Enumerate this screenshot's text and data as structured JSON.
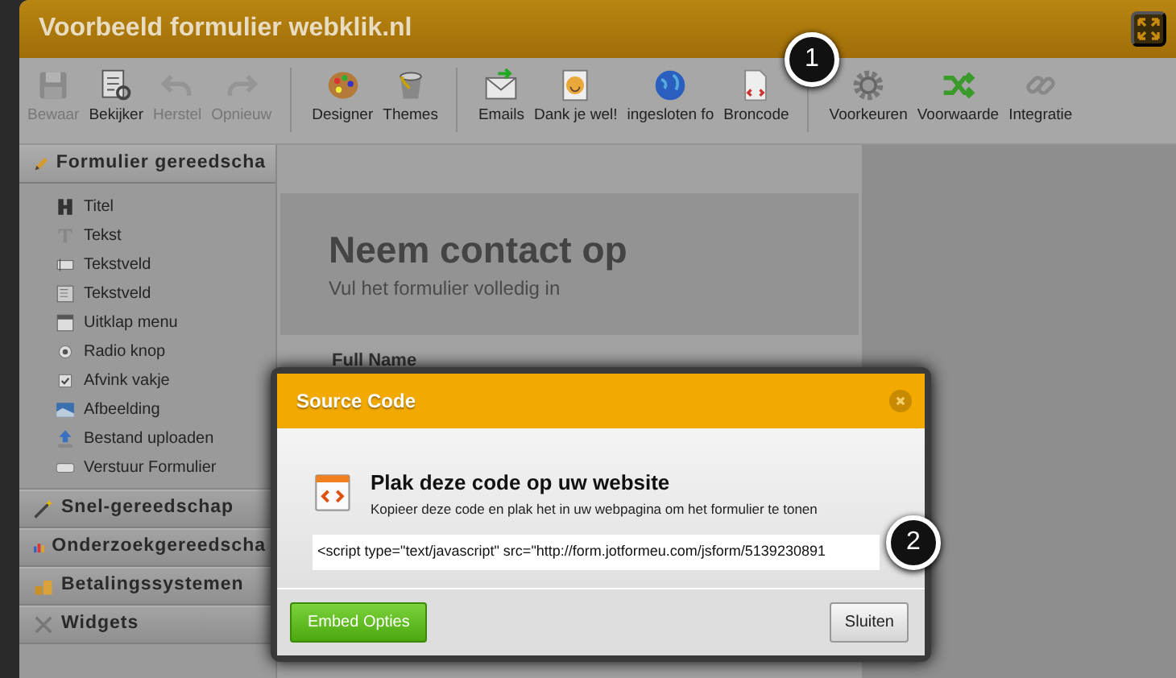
{
  "window": {
    "title": "Voorbeeld formulier webklik.nl"
  },
  "toolbar": {
    "groups": [
      [
        {
          "label": "Bewaar",
          "disabled": true
        },
        {
          "label": "Bekijker",
          "disabled": false
        },
        {
          "label": "Herstel",
          "disabled": true
        },
        {
          "label": "Opnieuw",
          "disabled": true
        }
      ],
      [
        {
          "label": "Designer",
          "disabled": false
        },
        {
          "label": "Themes",
          "disabled": false
        }
      ],
      [
        {
          "label": "Emails",
          "disabled": false
        },
        {
          "label": "Dank je wel!",
          "disabled": false
        },
        {
          "label": "ingesloten fo",
          "disabled": false
        },
        {
          "label": "Broncode",
          "disabled": false
        }
      ],
      [
        {
          "label": "Voorkeuren",
          "disabled": false
        },
        {
          "label": "Voorwaarde",
          "disabled": false
        },
        {
          "label": "Integratie",
          "disabled": false
        }
      ]
    ]
  },
  "sidebar": {
    "sections": [
      {
        "title": "Formulier gereedscha",
        "expanded": true,
        "items": [
          {
            "label": "Titel"
          },
          {
            "label": "Tekst"
          },
          {
            "label": "Tekstveld"
          },
          {
            "label": "Tekstveld"
          },
          {
            "label": "Uitklap menu"
          },
          {
            "label": "Radio knop"
          },
          {
            "label": "Afvink vakje"
          },
          {
            "label": "Afbeelding"
          },
          {
            "label": "Bestand uploaden"
          },
          {
            "label": "Verstuur Formulier"
          }
        ]
      },
      {
        "title": "Snel-gereedschap",
        "expanded": false
      },
      {
        "title": "Onderzoekgereedscha",
        "expanded": false
      },
      {
        "title": "Betalingssystemen",
        "expanded": false
      },
      {
        "title": "Widgets",
        "expanded": false
      }
    ]
  },
  "form": {
    "heading": "Neem contact op",
    "subheading": "Vul het formulier volledig in",
    "field_label": "Full Name"
  },
  "dialog": {
    "title": "Source Code",
    "heading": "Plak deze code op uw website",
    "description": "Kopieer deze code en plak het in uw webpagina om het formulier te tonen",
    "code": "<script type=\"text/javascript\" src=\"http://form.jotformeu.com/jsform/5139230891",
    "buttons": [
      {
        "label": "Embed Opties",
        "kind": "primary"
      },
      {
        "label": "Sluiten",
        "kind": "secondary"
      }
    ]
  },
  "callouts": [
    "1",
    "2"
  ]
}
